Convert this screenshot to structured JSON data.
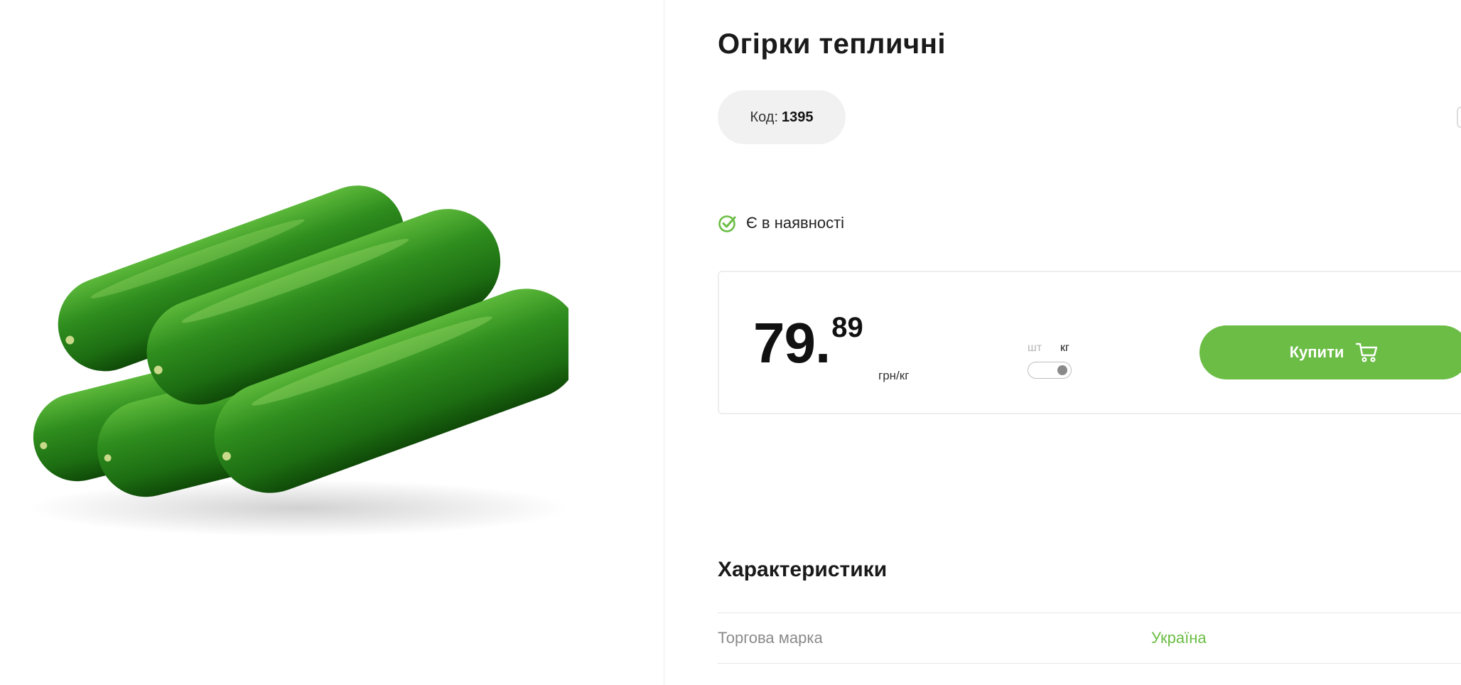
{
  "product": {
    "title": "Огірки тепличні",
    "code_label": "Код:",
    "code_value": "1395",
    "image_alt": "cucumbers"
  },
  "availability": {
    "text": "Є в наявності",
    "icon": "check-circle-icon",
    "color": "#6bbd45"
  },
  "price": {
    "main": "79.",
    "cents": "89",
    "unit": "грн/кг"
  },
  "unit_toggle": {
    "option_pcs": "шт",
    "option_kg": "кг",
    "selected": "кг"
  },
  "buy_button": {
    "label": "Купити",
    "icon": "cart-icon",
    "color": "#6bbd45"
  },
  "specs": {
    "title": "Характеристики",
    "rows": [
      {
        "label": "Торгова марка",
        "value": "Україна"
      }
    ]
  }
}
